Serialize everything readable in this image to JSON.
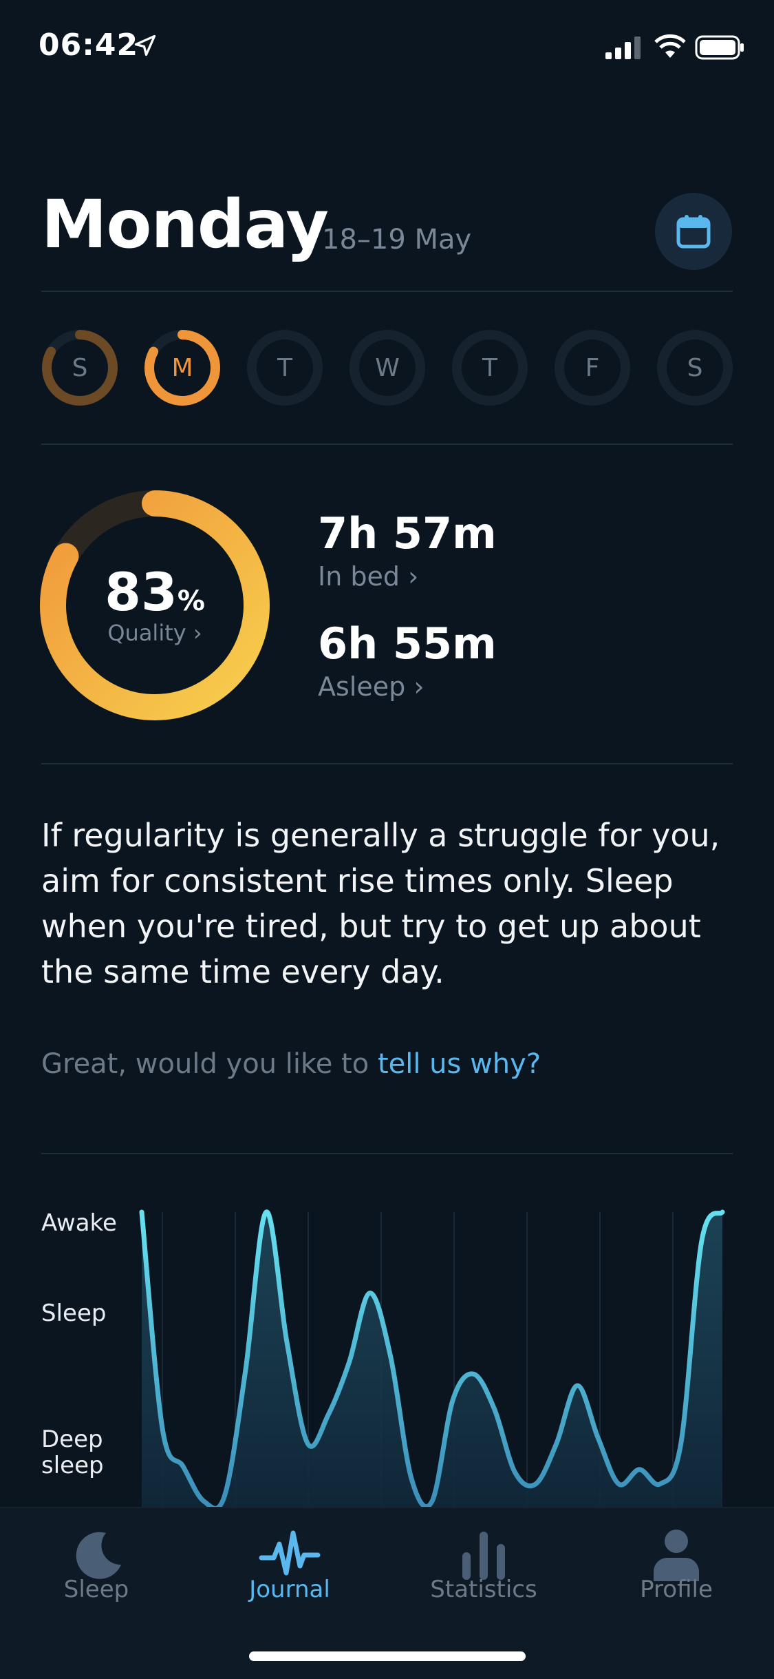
{
  "status": {
    "time": "06:42"
  },
  "header": {
    "title": "Monday",
    "date_range": "18–19 May",
    "calendar_icon": "calendar-icon"
  },
  "week": [
    {
      "letter": "S",
      "progress": 0.83,
      "color": "#6b4a25"
    },
    {
      "letter": "M",
      "progress": 0.83,
      "color": "#f0963a",
      "selected": true
    },
    {
      "letter": "T",
      "progress": 0
    },
    {
      "letter": "W",
      "progress": 0
    },
    {
      "letter": "T",
      "progress": 0
    },
    {
      "letter": "F",
      "progress": 0
    },
    {
      "letter": "S",
      "progress": 0
    }
  ],
  "summary": {
    "quality_value": "83",
    "quality_unit": "%",
    "quality_label": "Quality",
    "quality_progress": 0.83,
    "in_bed_value": "7h 57m",
    "in_bed_label": "In bed",
    "asleep_value": "6h 55m",
    "asleep_label": "Asleep"
  },
  "tip": "If regularity is generally a struggle for you, aim for consistent rise times only. Sleep when you're tired, but try to get up about the same time every day.",
  "feedback": {
    "text": "Great, would you like to ",
    "link": "tell us why?"
  },
  "chart_data": {
    "type": "area",
    "y_levels": [
      "Awake",
      "Sleep",
      "Deep\nsleep"
    ],
    "grid": "vertical",
    "values": [
      1.0,
      0.25,
      0.12,
      0.0,
      0.02,
      0.45,
      1.0,
      0.55,
      0.2,
      0.3,
      0.48,
      0.72,
      0.5,
      0.08,
      0.0,
      0.35,
      0.44,
      0.32,
      0.1,
      0.06,
      0.2,
      0.4,
      0.22,
      0.06,
      0.11,
      0.06,
      0.2,
      0.9,
      1.0
    ]
  },
  "tabs": [
    {
      "label": "Sleep",
      "icon": "moon-icon",
      "active": false
    },
    {
      "label": "Journal",
      "icon": "pulse-icon",
      "active": true
    },
    {
      "label": "Statistics",
      "icon": "bar-chart-icon",
      "active": false
    },
    {
      "label": "Profile",
      "icon": "person-icon",
      "active": false
    }
  ],
  "colors": {
    "accent": "#5ab8ee",
    "ring_orange": "#f0963a",
    "ring_yellow": "#f7cf4e",
    "chart_line": "#5fd6ea"
  }
}
